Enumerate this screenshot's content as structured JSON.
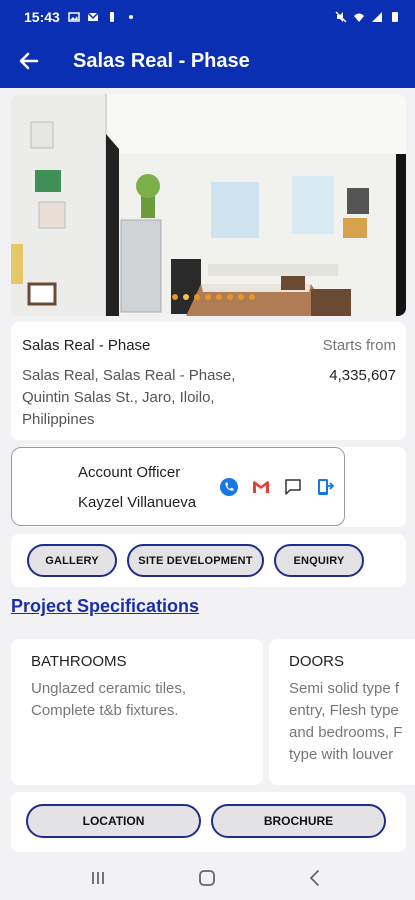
{
  "status_bar": {
    "time": "15:43"
  },
  "app_bar": {
    "title": "Salas Real - Phase"
  },
  "gallery": {
    "dot_count": 8,
    "active_dot": 1
  },
  "project": {
    "name": "Salas Real - Phase",
    "starts_from_label": "Starts from",
    "address": "Salas Real, Salas Real - Phase, Quintin Salas St., Jaro, Iloilo, Philippines",
    "price": "4,335,607"
  },
  "officer": {
    "role": "Account Officer",
    "name": "Kayzel Villanueva"
  },
  "tabs": {
    "gallery": "GALLERY",
    "site_development": "SITE DEVELOPMENT",
    "enquiry": "ENQUIRY"
  },
  "specifications": {
    "title": "Project Specifications",
    "items": [
      {
        "heading": "BATHROOMS",
        "description": "Unglazed ceramic tiles, Complete t&b fixtures."
      },
      {
        "heading": "DOORS",
        "description": "Semi solid type f entry, Flesh type and bedrooms, F type with louver"
      }
    ]
  },
  "actions": {
    "location": "LOCATION",
    "brochure": "BROCHURE"
  },
  "colors": {
    "primary": "#0a2fb3",
    "pill_border": "#1f2d8a",
    "link": "#1a2fa8"
  }
}
